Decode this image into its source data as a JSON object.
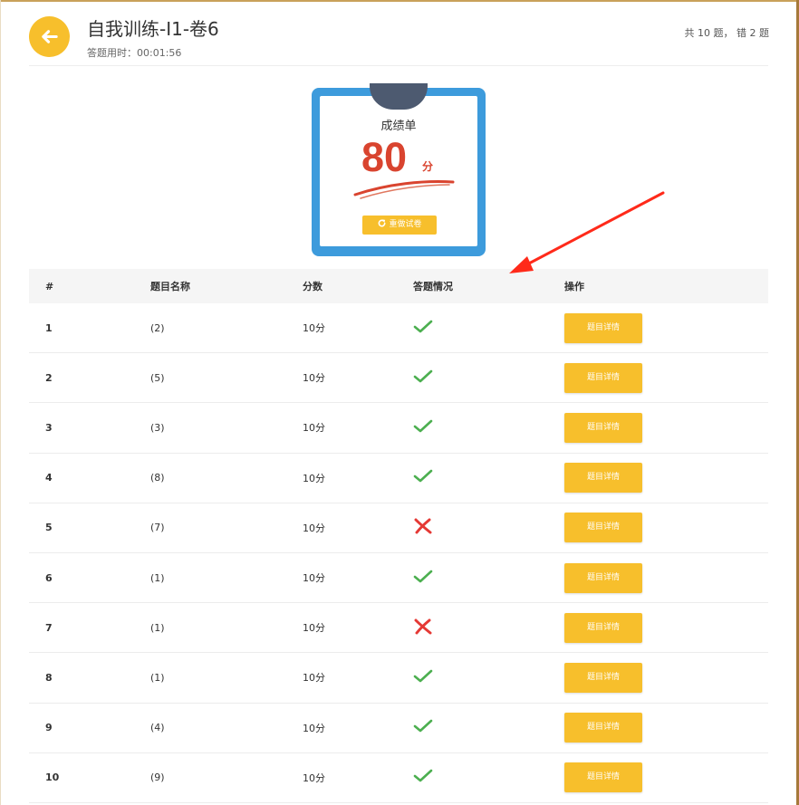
{
  "header": {
    "title": "自我训练-I1-卷6",
    "elapsed_label": "答题用时：00:01:56",
    "summary": "共 10 题， 错 2 题"
  },
  "score_card": {
    "title": "成绩单",
    "score": "80",
    "unit": "分",
    "redo_label": "重做试卷"
  },
  "table": {
    "headers": [
      "#",
      "题目名称",
      "分数",
      "答题情况",
      "操作"
    ],
    "detail_label": "题目详情",
    "rows": [
      {
        "no": "1",
        "name": "(2)",
        "score": "10分",
        "status": "correct"
      },
      {
        "no": "2",
        "name": "(5)",
        "score": "10分",
        "status": "correct"
      },
      {
        "no": "3",
        "name": "(3)",
        "score": "10分",
        "status": "correct"
      },
      {
        "no": "4",
        "name": "(8)",
        "score": "10分",
        "status": "correct"
      },
      {
        "no": "5",
        "name": "(7)",
        "score": "10分",
        "status": "wrong"
      },
      {
        "no": "6",
        "name": "(1)",
        "score": "10分",
        "status": "correct"
      },
      {
        "no": "7",
        "name": "(1)",
        "score": "10分",
        "status": "wrong"
      },
      {
        "no": "8",
        "name": "(1)",
        "score": "10分",
        "status": "correct"
      },
      {
        "no": "9",
        "name": "(4)",
        "score": "10分",
        "status": "correct"
      },
      {
        "no": "10",
        "name": "(9)",
        "score": "10分",
        "status": "correct"
      }
    ]
  },
  "colors": {
    "accent": "#f7bf2c",
    "card_border": "#3d9bdc",
    "score": "#d9442f",
    "correct": "#4caf50",
    "wrong": "#e53935",
    "annotation_arrow": "#ff2a1a"
  },
  "icons": {
    "back": "arrow-left-icon",
    "redo": "refresh-icon",
    "correct": "check-icon",
    "wrong": "cross-icon"
  }
}
